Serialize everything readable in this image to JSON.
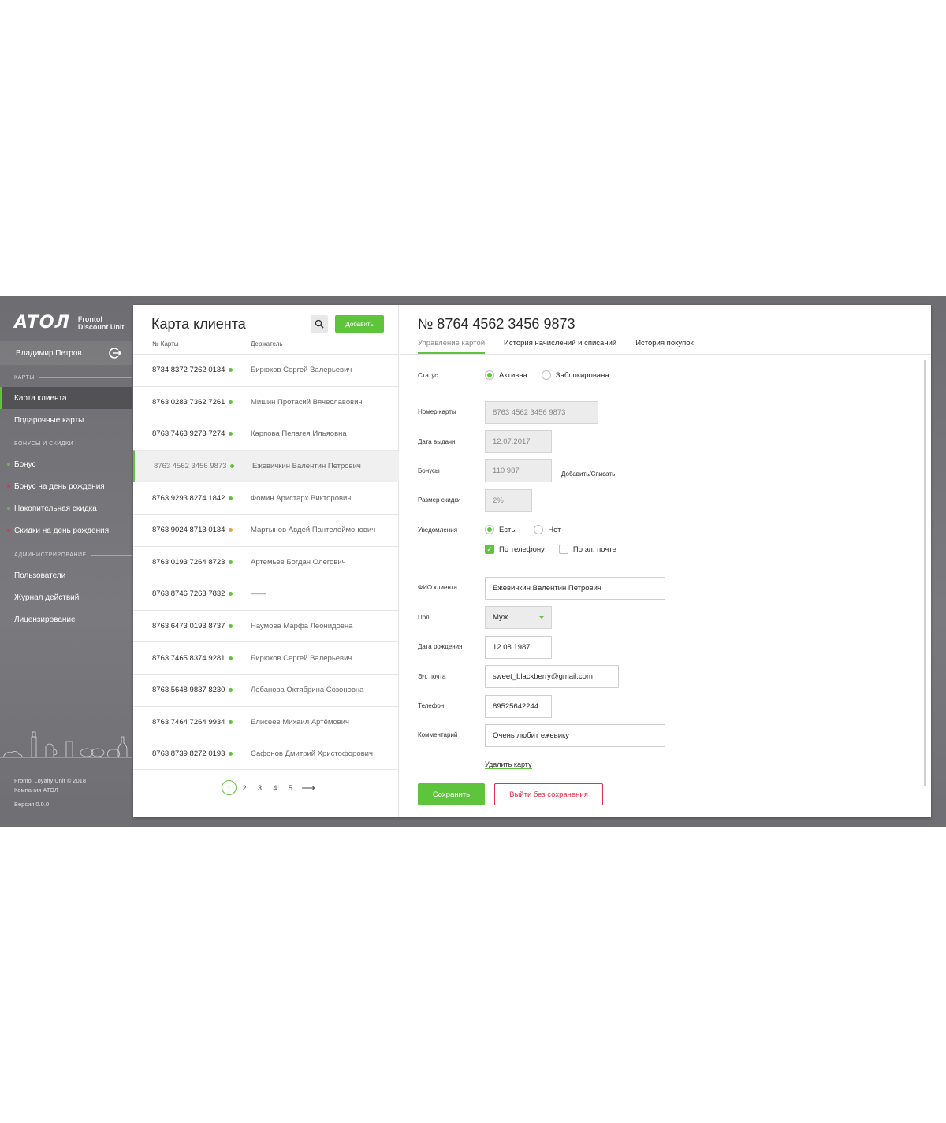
{
  "sidebar": {
    "logo": "ATOЛ",
    "logo_sub_1": "Frontol",
    "logo_sub_2": "Discount Unit",
    "user_name": "Владимир Петров",
    "section_cards": "КАРТЫ",
    "section_bonus": "БОНУСЫ И СКИДКИ",
    "section_admin": "АДМИНИСТРИРОВАНИЕ",
    "items": [
      {
        "label": "Карта клиента"
      },
      {
        "label": "Подарочные карты"
      },
      {
        "label": "Бонус"
      },
      {
        "label": "Бонус на день рождения"
      },
      {
        "label": "Накопительная скидка"
      },
      {
        "label": "Скидки на день рождения"
      },
      {
        "label": "Пользователи"
      },
      {
        "label": "Журнал действий"
      },
      {
        "label": "Лицензирование"
      }
    ],
    "footer_1": "Frontol Loyalty Unit © 2018",
    "footer_2": "Компания АТОЛ",
    "footer_3": "Версия 0.0.0",
    "colors": {
      "active": "#5dc43c",
      "inactive": "#e0304a"
    }
  },
  "list": {
    "title": "Карта клиента",
    "add_label": "Добавить",
    "col_number": "№ Карты",
    "col_holder": "Держатель",
    "rows": [
      {
        "number": "8734 8372 7262 0134",
        "holder": "Бирюков Сергей Валерьевич",
        "status": "green"
      },
      {
        "number": "8763 0283 7362 7261",
        "holder": "Мишин Протасий Вячеславович",
        "status": "green"
      },
      {
        "number": "8763 7463 9273 7274",
        "holder": "Карпова Пелагея Ильяовна",
        "status": "green"
      },
      {
        "number": "8763 4562 3456 9873",
        "holder": "Ежевичкин Валентин Петрович",
        "status": "green"
      },
      {
        "number": "8763 9293 8274 1842",
        "holder": "Фомин Аристарх Викторович",
        "status": "green"
      },
      {
        "number": "8763 9024 8713 0134",
        "holder": "Мартынов Авдей Пантелеймонович",
        "status": "orange"
      },
      {
        "number": "8763 0193 7264 8723",
        "holder": "Артемьев Богдан Олегович",
        "status": "green"
      },
      {
        "number": "8763 8746 7263 7832",
        "holder": "——",
        "status": "green"
      },
      {
        "number": "8763 6473 0193 8737",
        "holder": "Наумова Марфа Леонидовна",
        "status": "green"
      },
      {
        "number": "8763 7465 8374 9281",
        "holder": "Бирюков Сергей Валерьевич",
        "status": "green"
      },
      {
        "number": "8763 5648 9837 8230",
        "holder": "Лобанова Октябрина Созоновна",
        "status": "green"
      },
      {
        "number": "8763 7464 7264 9934",
        "holder": "Елисеев Михаил Артёмович",
        "status": "green"
      },
      {
        "number": "8763 8739 8272 0193",
        "holder": "Сафонов Дмитрий Христофорович",
        "status": "green"
      }
    ],
    "pages": [
      "1",
      "2",
      "3",
      "4",
      "5"
    ]
  },
  "detail": {
    "title": "№ 8764 4562 3456 9873",
    "tabs": [
      "Управление картой",
      "История начислений и списаний",
      "История покупок"
    ],
    "labels": {
      "status": "Статус",
      "card_number": "Номер карты",
      "issue_date": "Дата выдачи",
      "bonuses": "Бонусы",
      "discount": "Размер скидки",
      "notifications": "Уведомления",
      "full_name": "ФИО клиента",
      "gender": "Пол",
      "birth_date": "Дата рождения",
      "email": "Эл. почта",
      "phone": "Телефон",
      "comment": "Комментарий"
    },
    "status_active": "Активна",
    "status_blocked": "Заблокирована",
    "card_number": "8763 4562 3456 9873",
    "issue_date": "12.07.2017",
    "bonuses": "110 987",
    "bonus_link": "Добавить/Списать",
    "discount": "2%",
    "notif_yes": "Есть",
    "notif_no": "Нет",
    "by_phone": "По телефону",
    "by_email": "По эл. почте",
    "full_name": "Ежевичкин Валентин Петрович",
    "gender": "Муж",
    "birth_date": "12.08.1987",
    "email": "sweet_blackberry@gmail.com",
    "phone": "89525642244",
    "comment": "Очень любит ежевику",
    "delete_link": "Удалить карту",
    "save_label": "Сохранить",
    "exit_label": "Выйти без сохранения"
  }
}
